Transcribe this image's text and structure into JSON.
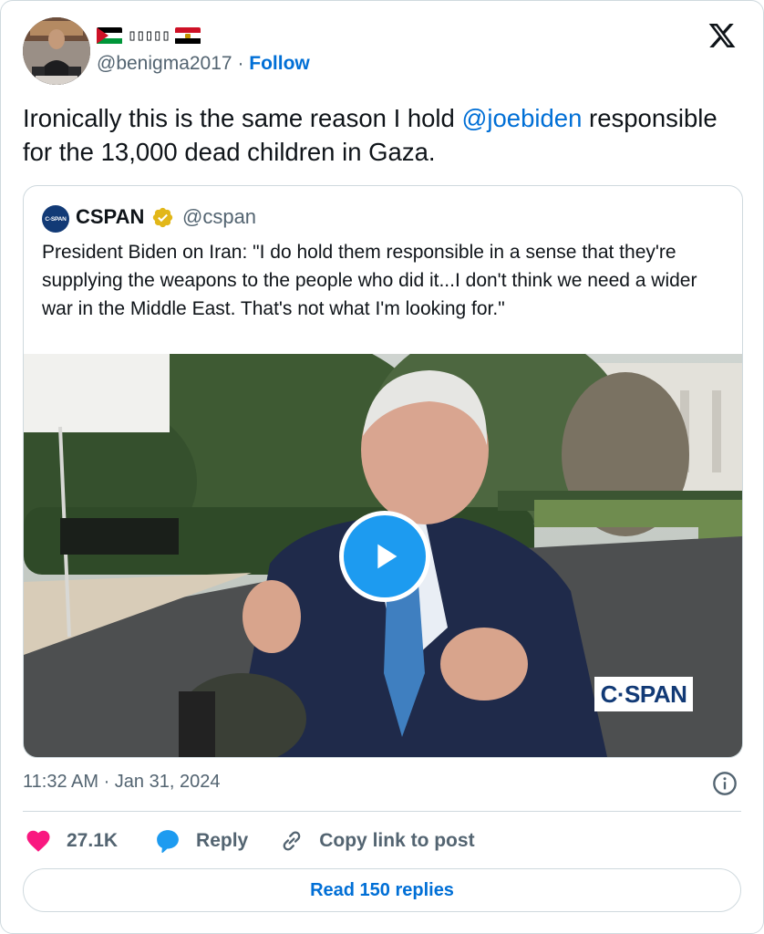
{
  "author": {
    "display_name_glyphs": "▯▯▯▯▯",
    "handle": "@benigma2017",
    "separator": "·",
    "follow_label": "Follow",
    "flags": [
      "palestine-flag",
      "egypt-flag"
    ]
  },
  "tweet": {
    "text_before": "Ironically this is the same reason I hold ",
    "mention": "@joebiden",
    "text_after": " responsible for the 13,000 dead children in Gaza."
  },
  "quote": {
    "avatar_text": "C-SPAN",
    "name": "CSPAN",
    "handle": "@cspan",
    "text": "President Biden on Iran: \"I do hold them responsible in a sense that they're supplying the weapons to the people who did it...I don't think we need a wider war in the Middle East. That's not what I'm looking for.\"",
    "video_watermark": "C·SPAN"
  },
  "meta": {
    "timestamp": "11:32 AM · Jan 31, 2024"
  },
  "actions": {
    "likes": "27.1K",
    "reply_label": "Reply",
    "copy_label": "Copy link to post"
  },
  "read_replies_label": "Read 150 replies",
  "colors": {
    "accent": "#006fd6",
    "like": "#f91880",
    "reply_icon": "#1d9bf0",
    "border": "#cfd9de",
    "muted": "#536471",
    "verified_gold": "#e2b719"
  }
}
